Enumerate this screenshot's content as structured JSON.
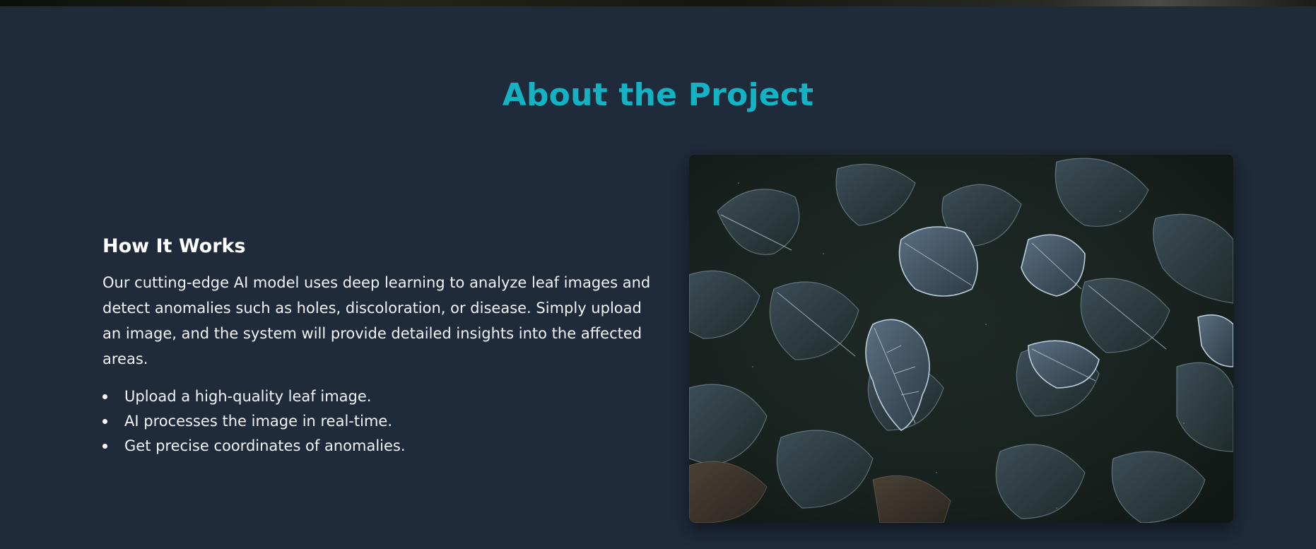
{
  "about": {
    "title": "About the Project",
    "how_it_works": {
      "heading": "How It Works",
      "description": "Our cutting-edge AI model uses deep learning to analyze leaf images and detect anomalies such as holes, discoloration, or disease. Simply upload an image, and the system will provide detailed insights into the affected areas.",
      "steps": [
        "Upload a high-quality leaf image.",
        "AI processes the image in real-time.",
        "Get precise coordinates of anomalies."
      ]
    },
    "image": {
      "subject": "frosted leaves on dark ground"
    }
  },
  "colors": {
    "background": "#1f2a3a",
    "accent": "#14b3c4",
    "text": "#ffffff"
  }
}
